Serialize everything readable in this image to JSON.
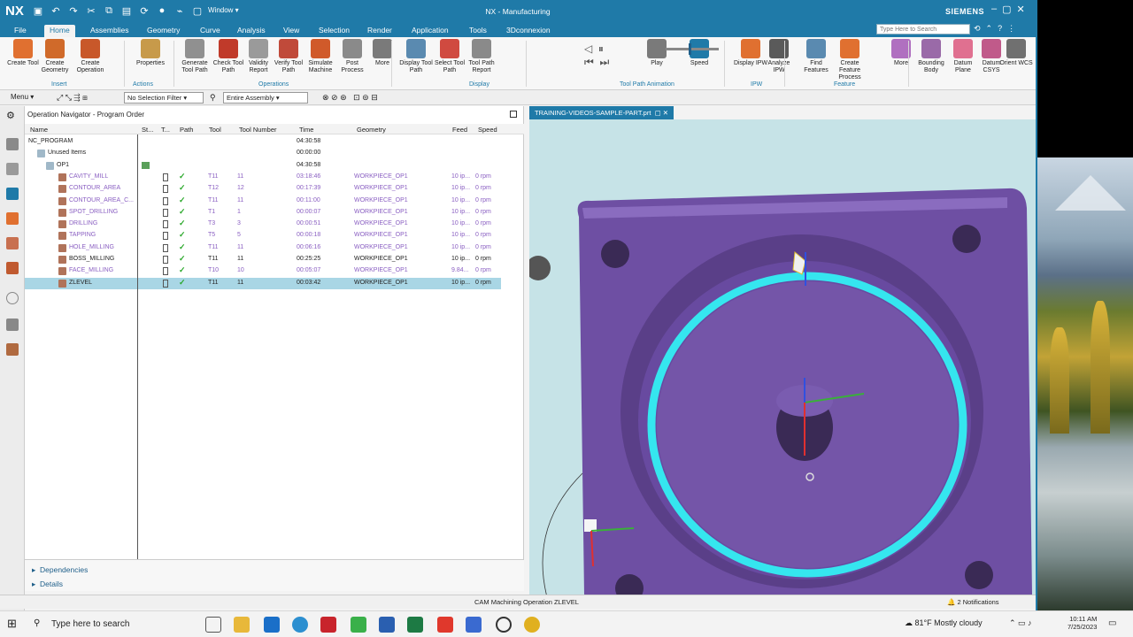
{
  "titlebar": {
    "logo": "NX",
    "window_menu": "Window ▾",
    "title": "NX - Manufacturing",
    "brand": "SIEMENS",
    "help_search_placeholder": "Type Here to Search"
  },
  "tabs": [
    "File",
    "Home",
    "Assemblies",
    "Geometry",
    "Curve",
    "Analysis",
    "View",
    "Selection",
    "Render",
    "Application",
    "Tools",
    "3Dconnexion"
  ],
  "ribbon": {
    "buttons": [
      {
        "label": "Create Tool",
        "color": "#e07030"
      },
      {
        "label": "Create Geometry",
        "color": "#d06a2a"
      },
      {
        "label": "Create Operation",
        "color": "#c8582a"
      },
      {
        "label": "Properties",
        "color": "#c79a4a"
      },
      {
        "label": "Generate Tool Path",
        "color": "#909090"
      },
      {
        "label": "Check Tool Path",
        "color": "#c03a2a"
      },
      {
        "label": "Validity Report",
        "color": "#9a9a9a"
      },
      {
        "label": "Verify Tool Path",
        "color": "#c04a3a"
      },
      {
        "label": "Simulate Machine",
        "color": "#d05a2a"
      },
      {
        "label": "Post Process",
        "color": "#8a8a8a"
      },
      {
        "label": "More",
        "color": "#7a7a7a"
      },
      {
        "label": "Display Tool Path",
        "color": "#5a8ab0"
      },
      {
        "label": "Select Tool Path",
        "color": "#d04a40"
      },
      {
        "label": "Tool Path Report",
        "color": "#8a8a8a"
      },
      {
        "label": "Play",
        "color": "#7a7a7a"
      },
      {
        "label": "Speed",
        "color": "#1f7aa8"
      },
      {
        "label": "Display IPW",
        "color": "#e07030"
      },
      {
        "label": "Analyze IPW",
        "color": "#5a5a5a"
      },
      {
        "label": "Find Features",
        "color": "#5a8ab0"
      },
      {
        "label": "Create Feature Process",
        "color": "#e07030"
      },
      {
        "label": "More",
        "color": "#b070c0"
      },
      {
        "label": "Bounding Body",
        "color": "#9a6aa8"
      },
      {
        "label": "Datum Plane",
        "color": "#e07090"
      },
      {
        "label": "Datum CSYS",
        "color": "#c05a8a"
      },
      {
        "label": "Orient WCS",
        "color": "#707070"
      }
    ],
    "groups": [
      "Insert",
      "Actions",
      "Operations",
      "Display",
      "Tool Path Animation",
      "IPW",
      "Feature"
    ]
  },
  "toolrow": {
    "menu": "Menu ▾",
    "selection_filter": "No Selection Filter",
    "assembly_scope": "Entire Assembly"
  },
  "navigator": {
    "title": "Operation Navigator - Program Order",
    "columns": [
      "Name",
      "St...",
      "T...",
      "Path",
      "Tool",
      "Tool Number",
      "Time",
      "Geometry",
      "Feed",
      "Speed"
    ],
    "rows": [
      {
        "name": "NC_PROGRAM",
        "time": "04:30:58",
        "indent": 0,
        "type": "root"
      },
      {
        "name": "Unused Items",
        "time": "00:00:00",
        "indent": 1,
        "type": "folder"
      },
      {
        "name": "OP1",
        "time": "04:30:58",
        "indent": 1,
        "type": "folder"
      },
      {
        "name": "CAVITY_MILL",
        "tool": "T11",
        "tnum": "11",
        "time": "03:18:46",
        "geom": "WORKPIECE_OP1",
        "feed": "10 ip...",
        "speed": "0 rpm",
        "purple": true
      },
      {
        "name": "CONTOUR_AREA",
        "tool": "T12",
        "tnum": "12",
        "time": "00:17:39",
        "geom": "WORKPIECE_OP1",
        "feed": "10 ip...",
        "speed": "0 rpm",
        "purple": true
      },
      {
        "name": "CONTOUR_AREA_C...",
        "tool": "T11",
        "tnum": "11",
        "time": "00:11:00",
        "geom": "WORKPIECE_OP1",
        "feed": "10 ip...",
        "speed": "0 rpm",
        "purple": true
      },
      {
        "name": "SPOT_DRILLING",
        "tool": "T1",
        "tnum": "1",
        "time": "00:00:07",
        "geom": "WORKPIECE_OP1",
        "feed": "10 ip...",
        "speed": "0 rpm",
        "purple": true
      },
      {
        "name": "DRILLING",
        "tool": "T3",
        "tnum": "3",
        "time": "00:00:51",
        "geom": "WORKPIECE_OP1",
        "feed": "10 ip...",
        "speed": "0 rpm",
        "purple": true
      },
      {
        "name": "TAPPING",
        "tool": "T5",
        "tnum": "5",
        "time": "00:00:18",
        "geom": "WORKPIECE_OP1",
        "feed": "10 ip...",
        "speed": "0 rpm",
        "purple": true
      },
      {
        "name": "HOLE_MILLING",
        "tool": "T11",
        "tnum": "11",
        "time": "00:06:16",
        "geom": "WORKPIECE_OP1",
        "feed": "10 ip...",
        "speed": "0 rpm",
        "purple": true
      },
      {
        "name": "BOSS_MILLING",
        "tool": "T11",
        "tnum": "11",
        "time": "00:25:25",
        "geom": "WORKPIECE_OP1",
        "feed": "10 ip...",
        "speed": "0 rpm",
        "purple": false
      },
      {
        "name": "FACE_MILLING",
        "tool": "T10",
        "tnum": "10",
        "time": "00:05:07",
        "geom": "WORKPIECE_OP1",
        "feed": "9.84...",
        "speed": "0 rpm",
        "purple": true
      },
      {
        "name": "ZLEVEL",
        "tool": "T11",
        "tnum": "11",
        "time": "00:03:42",
        "geom": "WORKPIECE_OP1",
        "feed": "10 ip...",
        "speed": "0 rpm",
        "purple": false,
        "selected": true
      }
    ],
    "dependencies": "Dependencies",
    "details": "Details"
  },
  "graphics": {
    "tab_title": "TRAINING-VIDEOS-SAMPLE-PART.prt",
    "part_color": "#7455a8",
    "path_color": "#35e6ef"
  },
  "statusbar": {
    "message": "CAM Machining Operation ZLEVEL",
    "notifications": "2 Notifications"
  },
  "taskbar": {
    "search_placeholder": "Type here to search",
    "weather": "81°F  Mostly cloudy",
    "time": "10:11 AM",
    "date": "7/25/2023"
  }
}
